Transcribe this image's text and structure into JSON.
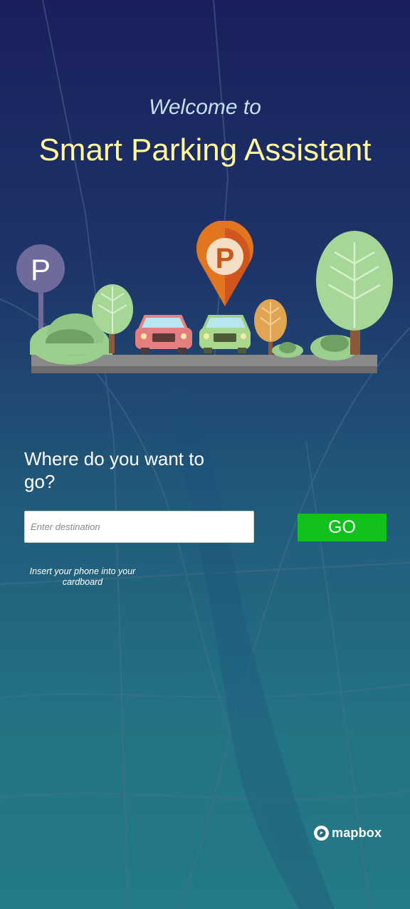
{
  "welcome_text": "Welcome to",
  "app_title": "Smart Parking Assistant",
  "hero": {
    "illustration": "parking-lot-illustration",
    "sign_letter": "P",
    "pin_letter": "P"
  },
  "destination": {
    "question": "Where do you want to go?",
    "input_value": "",
    "input_placeholder": "Enter destination",
    "go_label": "GO",
    "hint": "Insert your phone into your cardboard"
  },
  "attribution": {
    "logo_text": "mapbox"
  },
  "colors": {
    "background_top": "#1a1f5c",
    "background_bottom": "#247a86",
    "title": "#fff99a",
    "welcome": "#c7e0e6",
    "go_button": "#11c21d"
  }
}
